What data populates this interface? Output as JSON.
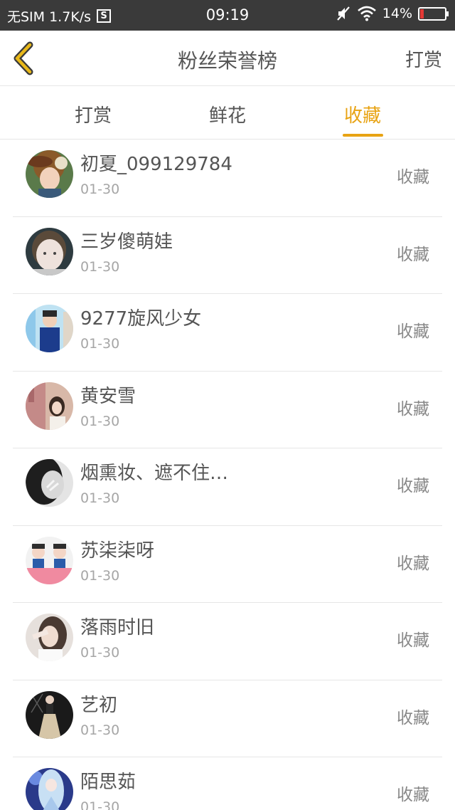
{
  "status_bar": {
    "sim_text": "无SIM 1.7K/s",
    "sim_icon_letter": "S",
    "time": "09:19",
    "battery_text": "14%",
    "battery_level": 0.14,
    "icons": [
      "mute-icon",
      "wifi-icon",
      "battery-icon"
    ]
  },
  "header": {
    "title": "粉丝荣誉榜",
    "right_action": "打赏",
    "back_icon": "chevron-left-icon",
    "accent_color": "#e8a313"
  },
  "tabs": [
    {
      "label": "打赏",
      "active": false
    },
    {
      "label": "鲜花",
      "active": false
    },
    {
      "label": "收藏",
      "active": true
    }
  ],
  "entries": [
    {
      "name": "初夏_099129784",
      "date": "01-30",
      "action": "收藏"
    },
    {
      "name": "三岁傻萌娃",
      "date": "01-30",
      "action": "收藏"
    },
    {
      "name": "9277旋风少女",
      "date": "01-30",
      "action": "收藏"
    },
    {
      "name": "黄安雪",
      "date": "01-30",
      "action": "收藏"
    },
    {
      "name": "烟熏妆、遮不住…",
      "date": "01-30",
      "action": "收藏"
    },
    {
      "name": "苏柒柒呀",
      "date": "01-30",
      "action": "收藏"
    },
    {
      "name": "落雨时旧",
      "date": "01-30",
      "action": "收藏"
    },
    {
      "name": "艺初",
      "date": "01-30",
      "action": "收藏"
    },
    {
      "name": "陌思茹",
      "date": "01-30",
      "action": "收藏"
    }
  ]
}
